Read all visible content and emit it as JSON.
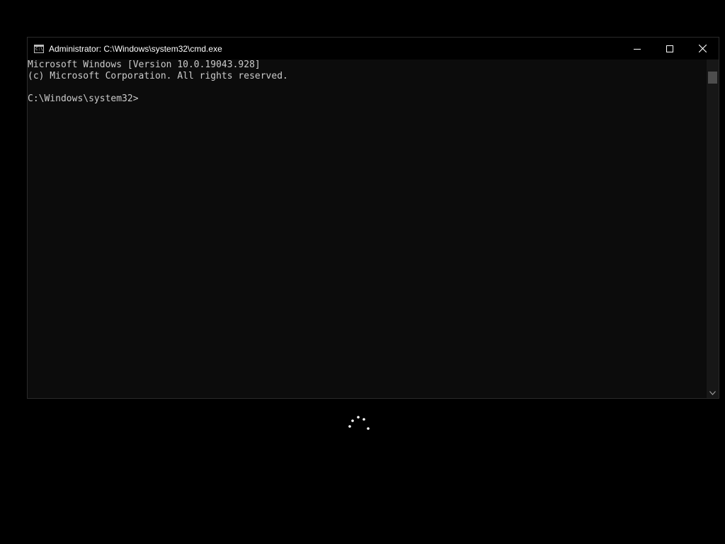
{
  "window": {
    "title": "Administrator: C:\\Windows\\system32\\cmd.exe",
    "app_icon_text": "C:\\",
    "controls": {
      "minimize": "minimize-icon",
      "maximize": "maximize-icon",
      "close": "close-icon"
    }
  },
  "console": {
    "lines": [
      "Microsoft Windows [Version 10.0.19043.928]",
      "(c) Microsoft Corporation. All rights reserved.",
      "",
      "C:\\Windows\\system32>"
    ]
  },
  "colors": {
    "desktop_bg": "#000000",
    "console_bg": "#0c0c0c",
    "console_text": "#cccccc",
    "titlebar_text": "#ffffff"
  },
  "status": {
    "loading_indicator": "spinner-icon"
  }
}
